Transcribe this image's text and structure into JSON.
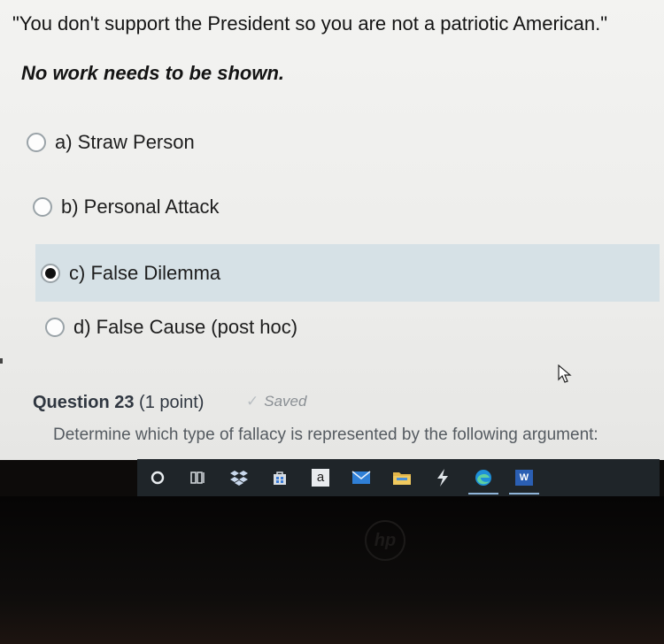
{
  "argument": "\"You don't support the President so you are not a patriotic American.\"",
  "instruction": "No work needs to be shown.",
  "options": [
    {
      "label": "a) Straw Person",
      "selected": false
    },
    {
      "label": "b) Personal Attack",
      "selected": false
    },
    {
      "label": "c) False Dilemma",
      "selected": true
    },
    {
      "label": "d) False Cause (post hoc)",
      "selected": false
    }
  ],
  "next_question": {
    "title": "Question 23",
    "points": "(1 point)",
    "status": "Saved",
    "prompt": "Determine which type of fallacy is represented by the following argument:"
  },
  "taskbar": {
    "icons": [
      "cortana-icon",
      "task-view-icon",
      "dropbox-icon",
      "store-icon",
      "amazon-icon",
      "mail-icon",
      "file-explorer-icon",
      "power-automate-icon",
      "edge-icon",
      "word-icon"
    ],
    "amazon_letter": "a",
    "word_letter": "W"
  },
  "colors": {
    "selected_bg": "#d6e1e6",
    "taskbar_bg": "#1f2529"
  }
}
